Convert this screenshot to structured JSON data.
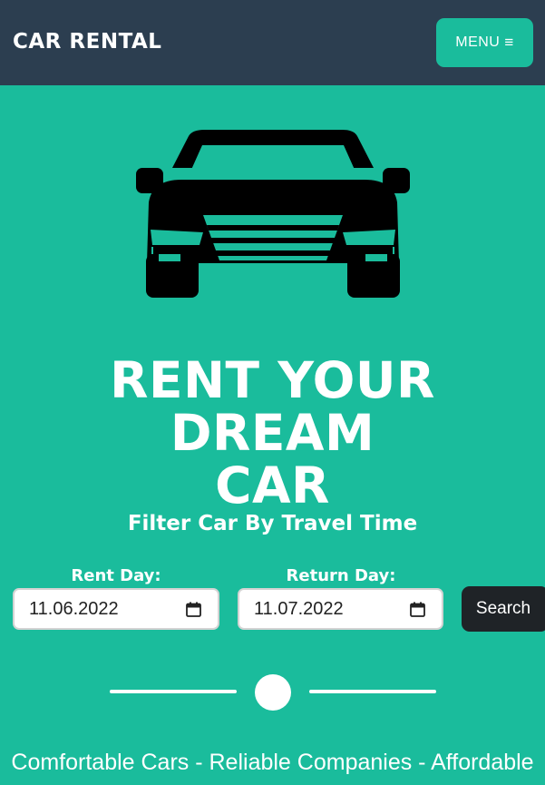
{
  "navbar": {
    "brand": "CAR RENTAL",
    "menu_label": "MENU",
    "menu_icon": "hamburger-icon"
  },
  "hero": {
    "icon": "car-front-icon",
    "headline_line1": "RENT YOUR DREAM",
    "headline_line2": "CAR"
  },
  "filter": {
    "title": "Filter Car By Travel Time",
    "rent_label": "Rent Day:",
    "rent_value": "11.06.2022",
    "return_label": "Return Day:",
    "return_value": "11.07.2022",
    "calendar_icon": "calendar-icon",
    "search_label": "Search"
  },
  "tagline": "Comfortable Cars - Reliable Companies - Affordable",
  "colors": {
    "page_bg": "#1abc9c",
    "navbar_bg": "#2c3e50",
    "search_bg": "#1f2327"
  }
}
